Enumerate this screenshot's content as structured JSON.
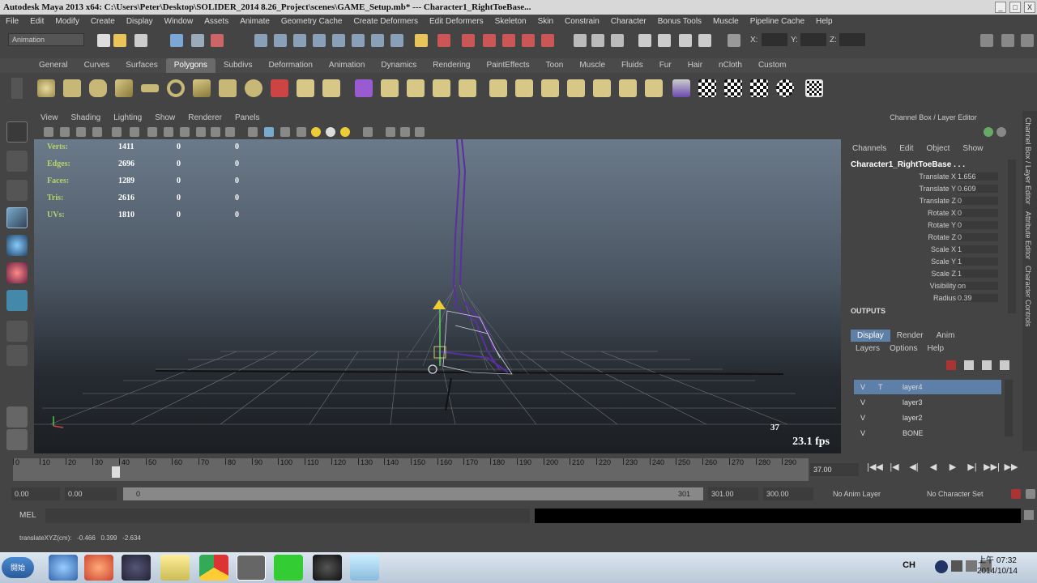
{
  "window": {
    "title": "Autodesk Maya 2013 x64: C:\\Users\\Peter\\Desktop\\SOLIDER_2014 8.26_Project\\scenes\\GAME_Setup.mb*  ---  Character1_RightToeBase...",
    "controls": [
      "_",
      "□",
      "X"
    ]
  },
  "menubar": [
    "File",
    "Edit",
    "Modify",
    "Create",
    "Display",
    "Window",
    "Assets",
    "Animate",
    "Geometry Cache",
    "Create Deformers",
    "Edit Deformers",
    "Skeleton",
    "Skin",
    "Constrain",
    "Character",
    "Bonus Tools",
    "Muscle",
    "Pipeline Cache",
    "Help"
  ],
  "status": {
    "mode": "Animation",
    "x_label": "X:",
    "y_label": "Y:",
    "z_label": "Z:"
  },
  "shelf_tabs": [
    "General",
    "Curves",
    "Surfaces",
    "Polygons",
    "Subdivs",
    "Deformation",
    "Animation",
    "Dynamics",
    "Rendering",
    "PaintEffects",
    "Toon",
    "Muscle",
    "Fluids",
    "Fur",
    "Hair",
    "nCloth",
    "Custom"
  ],
  "shelf_active": "Polygons",
  "panel_menu": [
    "View",
    "Shading",
    "Lighting",
    "Show",
    "Renderer",
    "Panels"
  ],
  "hud": [
    {
      "label": "Verts:",
      "a": "1411",
      "b": "0",
      "c": "0"
    },
    {
      "label": "Edges:",
      "a": "2696",
      "b": "0",
      "c": "0"
    },
    {
      "label": "Faces:",
      "a": "1289",
      "b": "0",
      "c": "0"
    },
    {
      "label": "Tris:",
      "a": "2616",
      "b": "0",
      "c": "0"
    },
    {
      "label": "UVs:",
      "a": "1810",
      "b": "0",
      "c": "0"
    }
  ],
  "viewport": {
    "frame": "37",
    "fps": "23.1 fps"
  },
  "channel_box": {
    "title": "Channel Box / Layer Editor",
    "menu": [
      "Channels",
      "Edit",
      "Object",
      "Show"
    ],
    "object": "Character1_RightToeBase . . .",
    "attributes": [
      {
        "name": "Translate X",
        "value": "1.656"
      },
      {
        "name": "Translate Y",
        "value": "0.609"
      },
      {
        "name": "Translate Z",
        "value": "0"
      },
      {
        "name": "Rotate X",
        "value": "0"
      },
      {
        "name": "Rotate Y",
        "value": "0"
      },
      {
        "name": "Rotate Z",
        "value": "0"
      },
      {
        "name": "Scale X",
        "value": "1"
      },
      {
        "name": "Scale Y",
        "value": "1"
      },
      {
        "name": "Scale Z",
        "value": "1"
      },
      {
        "name": "Visibility",
        "value": "on"
      },
      {
        "name": "Radius",
        "value": "0.39"
      }
    ],
    "outputs": "OUTPUTS"
  },
  "layer_editor": {
    "tabs": [
      "Display",
      "Render",
      "Anim"
    ],
    "menu": [
      "Layers",
      "Options",
      "Help"
    ],
    "layers": [
      {
        "v": "V",
        "t": "T",
        "name": "layer4"
      },
      {
        "v": "V",
        "t": "",
        "name": "layer3"
      },
      {
        "v": "V",
        "t": "",
        "name": "layer2"
      },
      {
        "v": "V",
        "t": "",
        "name": "BONE"
      }
    ]
  },
  "side_tabs": [
    "Channel Box / Layer Editor",
    "Attribute Editor",
    "Character Controls"
  ],
  "timeline": {
    "ticks": [
      "0",
      "10",
      "20",
      "30",
      "40",
      "50",
      "60",
      "70",
      "80",
      "90",
      "100",
      "110",
      "120",
      "130",
      "140",
      "150",
      "160",
      "170",
      "180",
      "190",
      "200",
      "210",
      "220",
      "230",
      "240",
      "250",
      "260",
      "270",
      "280",
      "290"
    ],
    "current": "37.00",
    "playback": [
      "|◀◀",
      "|◀",
      "◀|",
      "◀",
      "▶",
      "▶|",
      "▶▶|",
      "▶▶"
    ]
  },
  "range": {
    "start_outer": "0.00",
    "start_inner": "0.00",
    "slider_start": "0",
    "slider_end": "301",
    "end_inner": "301.00",
    "end_outer": "300.00",
    "anim_layer": "No Anim Layer",
    "char_set": "No Character Set"
  },
  "mel": {
    "label": "MEL"
  },
  "help_line": "translateXYZ(cm):   -0.466   0.399   -2.634",
  "taskbar": {
    "start": "開始",
    "lang": "CH",
    "clock_time": "上午 07:32",
    "clock_date": "2014/10/14"
  },
  "colors": {
    "accent": "#5d7fa8",
    "hud_label": "#b9d36b",
    "joint": "#5a2fa0"
  }
}
